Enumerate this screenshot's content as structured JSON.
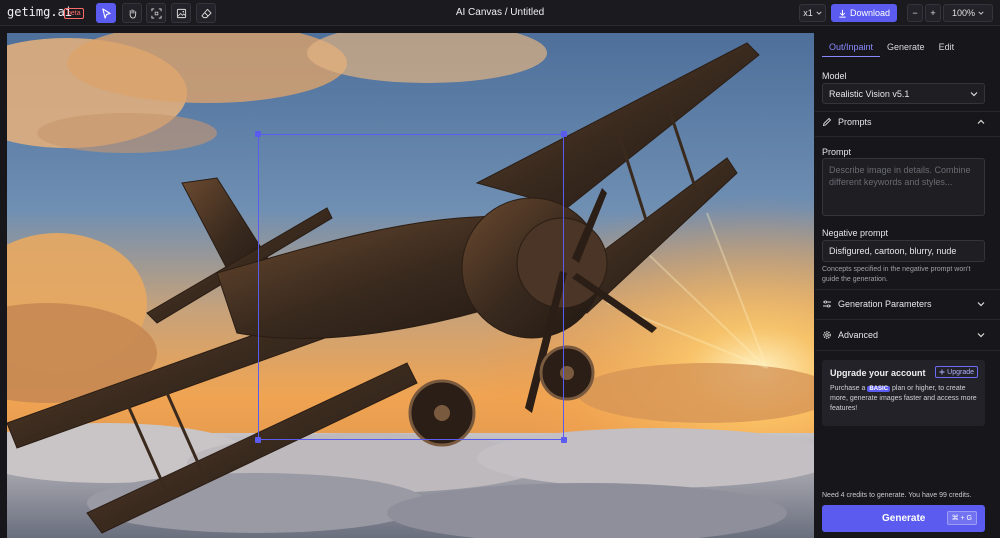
{
  "app": {
    "logo": "getimg.ai",
    "beta": "beta",
    "title": "AI Canvas / Untitled"
  },
  "toolbar": {
    "tools": [
      {
        "name": "select-tool",
        "icon": "cursor-icon",
        "active": true
      },
      {
        "name": "hand-tool",
        "icon": "hand-icon",
        "active": false
      },
      {
        "name": "frame-tool",
        "icon": "frame-select-icon",
        "active": false
      },
      {
        "name": "image-tool",
        "icon": "image-icon",
        "active": false
      },
      {
        "name": "eraser-tool",
        "icon": "eraser-icon",
        "active": false
      }
    ],
    "count": "x1",
    "download": "Download",
    "zoom": "100%",
    "minus": "−",
    "plus": "+"
  },
  "panel": {
    "tabs": [
      "Out/Inpaint",
      "Generate",
      "Edit"
    ],
    "active_tab": "Out/Inpaint",
    "model_label": "Model",
    "model_value": "Realistic Vision v5.1",
    "prompts_section": "Prompts",
    "prompt_label": "Prompt",
    "prompt_placeholder": "Describe image in details. Combine different keywords and styles...",
    "negative_label": "Negative prompt",
    "negative_value": "Disfigured, cartoon, blurry, nude",
    "negative_hint": "Concepts specified in the negative prompt won't guide the generation.",
    "gen_params": "Generation Parameters",
    "advanced": "Advanced",
    "upgrade": {
      "title": "Upgrade your account",
      "button": "Upgrade",
      "text_before": "Purchase a",
      "badge": "BASIC",
      "text_after": "plan or higher, to create more, generate images faster and access more features!"
    },
    "credits": "Need 4 credits to generate. You have 99 credits.",
    "generate": "Generate",
    "shortcut": "⌘ + G"
  },
  "colors": {
    "accent": "#5b5bf0",
    "background": "#17171b"
  }
}
